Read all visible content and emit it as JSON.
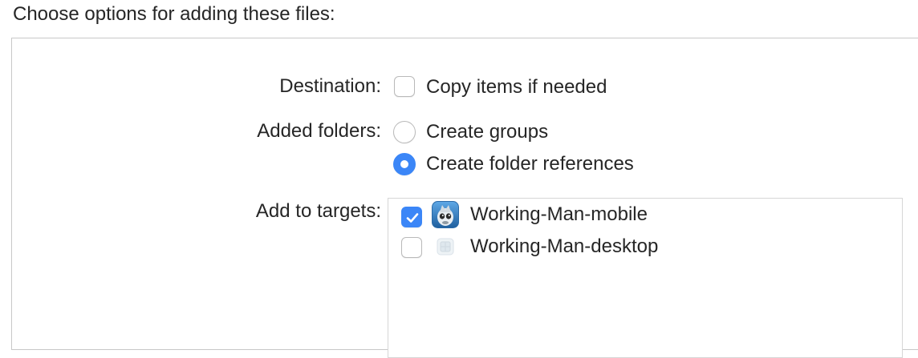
{
  "header": {
    "title": "Choose options for adding these files:"
  },
  "destination": {
    "label": "Destination:",
    "option_label": "Copy items if needed",
    "checked": false
  },
  "added_folders": {
    "label": "Added folders:",
    "options": [
      {
        "label": "Create groups",
        "selected": false
      },
      {
        "label": "Create folder references",
        "selected": true
      }
    ]
  },
  "targets": {
    "label": "Add to targets:",
    "items": [
      {
        "name": "Working-Man-mobile",
        "checked": true,
        "icon": "mobile-app-icon"
      },
      {
        "name": "Working-Man-desktop",
        "checked": false,
        "icon": "desktop-app-icon"
      }
    ]
  },
  "colors": {
    "accent": "#3b86f7",
    "border": "#c8c8c8",
    "text": "#262626"
  }
}
